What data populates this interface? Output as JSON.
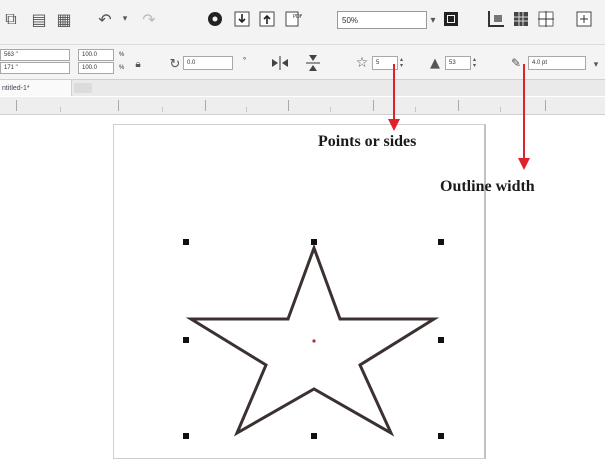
{
  "toolbar": {
    "zoom_value": "50%",
    "icons": [
      "copy-icon",
      "paste-icon",
      "paste-special-icon",
      "undo-icon",
      "redo-icon",
      "corel-connect-icon",
      "import-icon",
      "export-icon",
      "pdf-icon",
      "zoom-fit-icon",
      "snap-icon",
      "grid-icon",
      "guidelines-icon",
      "options-icon"
    ]
  },
  "property_bar": {
    "x_pos": "563 \"",
    "y_pos": "171 \"",
    "scale_w": "100.0",
    "scale_h": "100.0",
    "percent": "%",
    "rotation": "0.0",
    "degree": "°",
    "points_or_sides": "5",
    "sharpness": "53",
    "outline_width": "4.0 pt"
  },
  "document": {
    "tab_title": "ntitled-1*"
  },
  "annotations": {
    "points_or_sides": "Points or sides",
    "outline_width": "Outline width"
  },
  "colors": {
    "arrow": "#e0202a",
    "star_outline": "#3b3130"
  }
}
